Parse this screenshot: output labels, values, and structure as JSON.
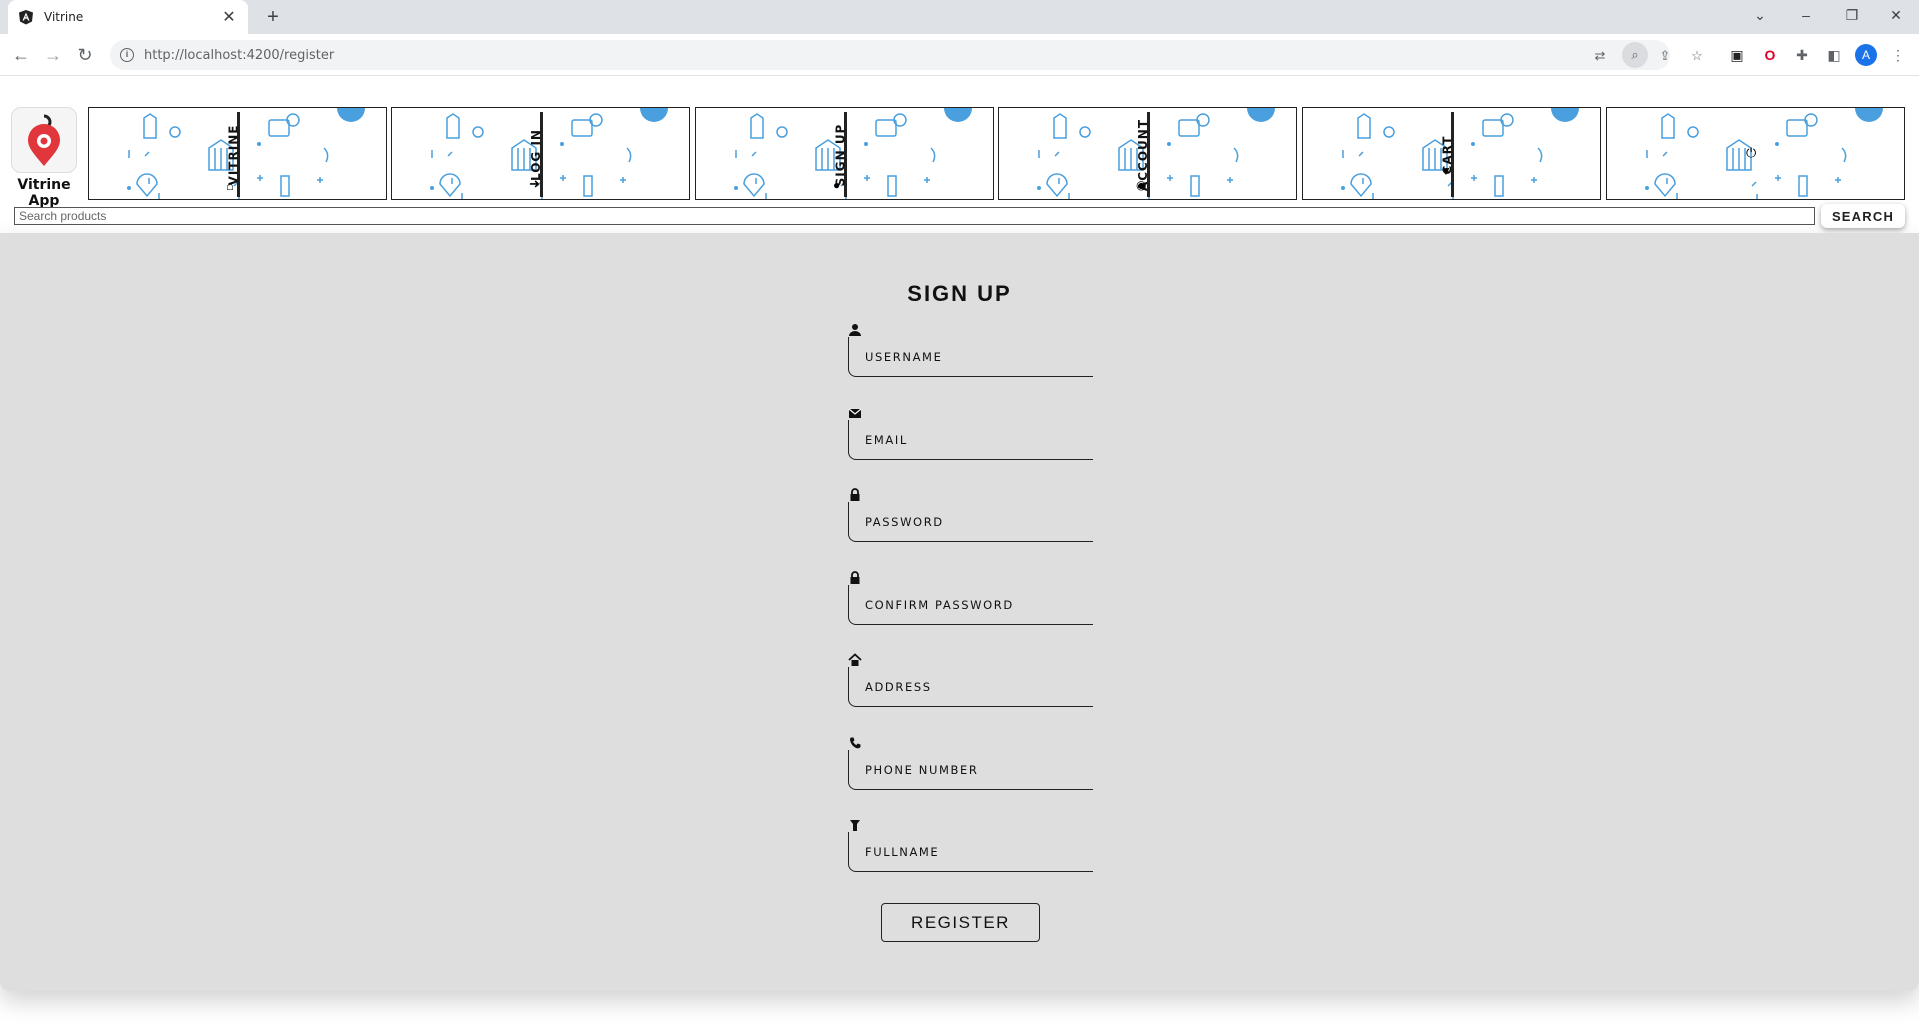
{
  "browser": {
    "tab_title": "Vitrine",
    "tab_close": "✕",
    "new_tab": "+",
    "url_host": "http://localhost",
    "url_rest": ":4200/register",
    "window_controls": {
      "dropdown": "⌄",
      "minimize": "–",
      "restore": "❐",
      "close": "✕"
    },
    "profile_initial": "A"
  },
  "header": {
    "logo_text": "Vitrine App",
    "nav": [
      {
        "label": "VITRINE",
        "icon": "home-icon"
      },
      {
        "label": "LOG IN",
        "icon": "login-icon"
      },
      {
        "label": "SIGN UP",
        "icon": "user-plus-icon"
      },
      {
        "label": "ACCOUNT",
        "icon": "account-icon"
      },
      {
        "label": "CART",
        "icon": "cart-icon"
      },
      {
        "label": "",
        "icon": "logout-icon"
      }
    ]
  },
  "search": {
    "placeholder": "Search products",
    "value": "",
    "button_label": "SEARCH"
  },
  "form": {
    "title": "SIGN UP",
    "fields": [
      {
        "label": "USERNAME",
        "icon": "user-icon"
      },
      {
        "label": "EMAIL",
        "icon": "envelope-icon"
      },
      {
        "label": "PASSWORD",
        "icon": "lock-icon"
      },
      {
        "label": "CONFIRM PASSWORD",
        "icon": "lock-icon"
      },
      {
        "label": "ADDRESS",
        "icon": "home-icon"
      },
      {
        "label": "PHONE NUMBER",
        "icon": "phone-icon"
      },
      {
        "label": "FULLNAME",
        "icon": "id-icon"
      }
    ],
    "submit_label": "REGISTER"
  },
  "colors": {
    "pattern_blue": "#4a9fde",
    "panel_bg": "#dedede",
    "chrome_bg": "#dee1e6"
  }
}
